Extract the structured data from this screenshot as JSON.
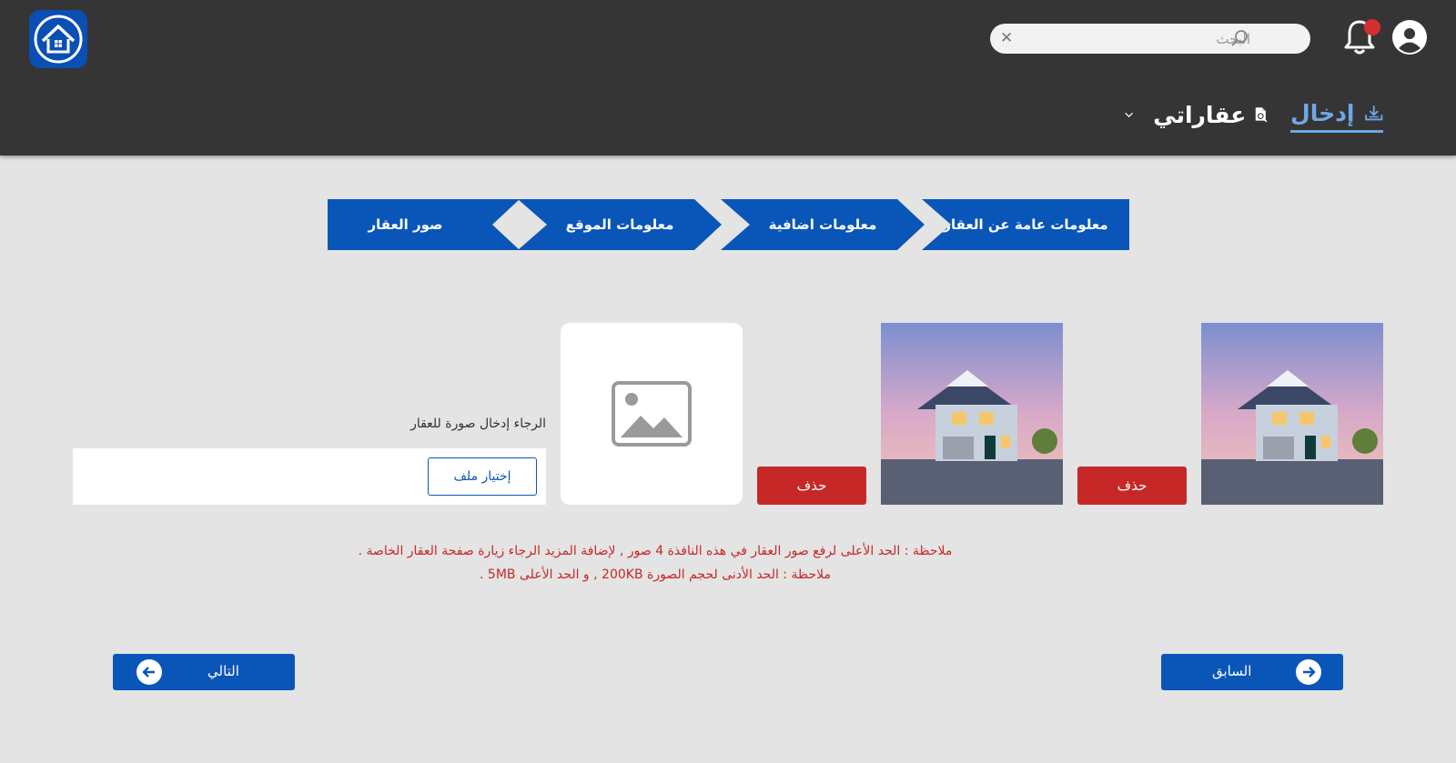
{
  "header": {
    "search": {
      "placeholder": "البحث"
    },
    "nav": {
      "input_label": "إدخال",
      "my_properties_label": "عقاراتي"
    }
  },
  "steps": [
    {
      "label": "معلومات عامة عن العقار"
    },
    {
      "label": "معلومات اضافية"
    },
    {
      "label": "معلومات الموقع"
    },
    {
      "label": "صور العقار"
    }
  ],
  "images": {
    "delete_label": "حذف"
  },
  "upload": {
    "label": "الرجاء إدخال صورة للعقار",
    "choose_file_label": "إختيار ملف"
  },
  "notes": {
    "line1": "ملاحظة : الحد الأعلى لرفع صور العقار في هذه النافذة 4 صور , لإضافة المزيد الرجاء زيارة صفحة العقار الخاصة .",
    "line2": "ملاحظة : الحد الأدنى لحجم الصورة 200KB , و الحد الأعلى 5MB ."
  },
  "navigation": {
    "next_label": "التالي",
    "previous_label": "السابق"
  },
  "colors": {
    "header_bg": "#353535",
    "page_bg": "#e4e4e4",
    "primary_blue": "#0a56b8",
    "danger_red": "#c62828",
    "active_tab": "#6fa8e6"
  }
}
